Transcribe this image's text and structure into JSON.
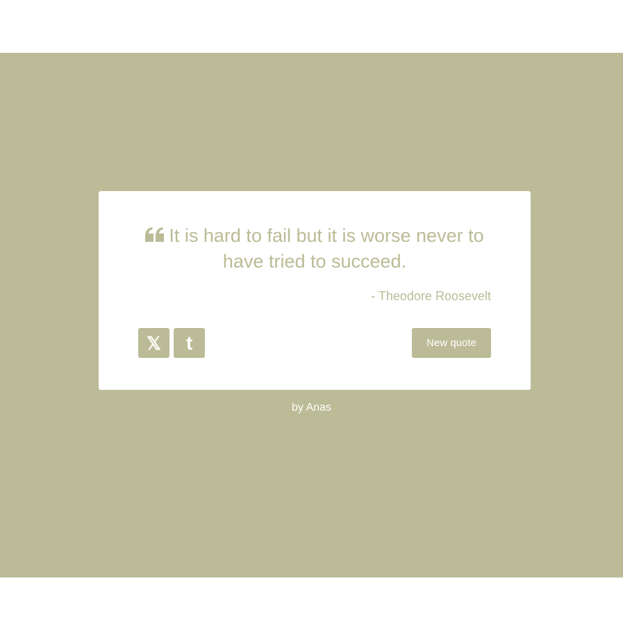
{
  "theme": {
    "accent": "#bbbb97",
    "card": "#ffffff",
    "text_on_accent": "#ffffff"
  },
  "quote": {
    "icon": "quote-left-icon",
    "text": "It is hard to fail but it is worse never to have tried to succeed.",
    "author": "- Theodore Roosevelt"
  },
  "actions": {
    "twitter_icon": "x-twitter-icon",
    "twitter_glyph": "𝕏",
    "tumblr_icon": "tumblr-icon",
    "tumblr_glyph": "t",
    "new_quote_label": "New quote"
  },
  "footer": {
    "prefix": "by",
    "author_link": "Anas"
  }
}
